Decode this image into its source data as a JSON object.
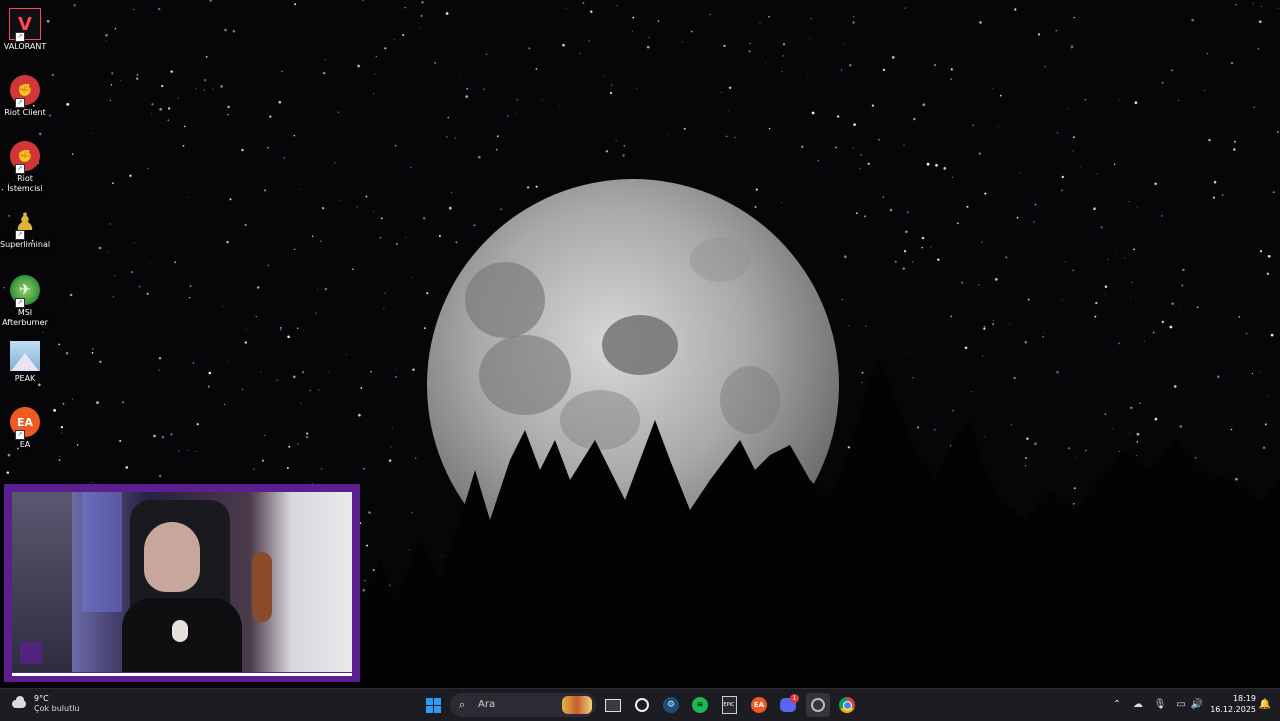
{
  "desktop": {
    "icons": [
      {
        "label": "VALORANT",
        "icon": "valorant-icon"
      },
      {
        "label": "Riot Client",
        "icon": "riot-client-icon"
      },
      {
        "label": "Riot İstemcisi",
        "icon": "riot-client-icon"
      },
      {
        "label": "Superliminal",
        "icon": "superliminal-icon"
      },
      {
        "label": "MSI Afterburner",
        "icon": "msi-afterburner-icon"
      },
      {
        "label": "PEAK",
        "icon": "peak-icon"
      },
      {
        "label": "EA",
        "icon": "ea-icon"
      }
    ]
  },
  "taskbar": {
    "weather": {
      "temp": "9°C",
      "condition": "Çok bulutlu"
    },
    "search": {
      "placeholder": "Ara"
    },
    "apps": [
      "windows-start-icon",
      "search-icon",
      "task-view-icon",
      "obs-icon",
      "steam-icon",
      "spotify-icon",
      "epic-games-icon",
      "ea-app-icon",
      "discord-icon",
      "browser-icon",
      "chrome-icon"
    ],
    "discord_badge": "1",
    "clock": {
      "time": "18:19",
      "date": "16.12.2025"
    }
  },
  "colors": {
    "webcam_frame": "#5b1f8f",
    "taskbar": "#1c1c22"
  }
}
